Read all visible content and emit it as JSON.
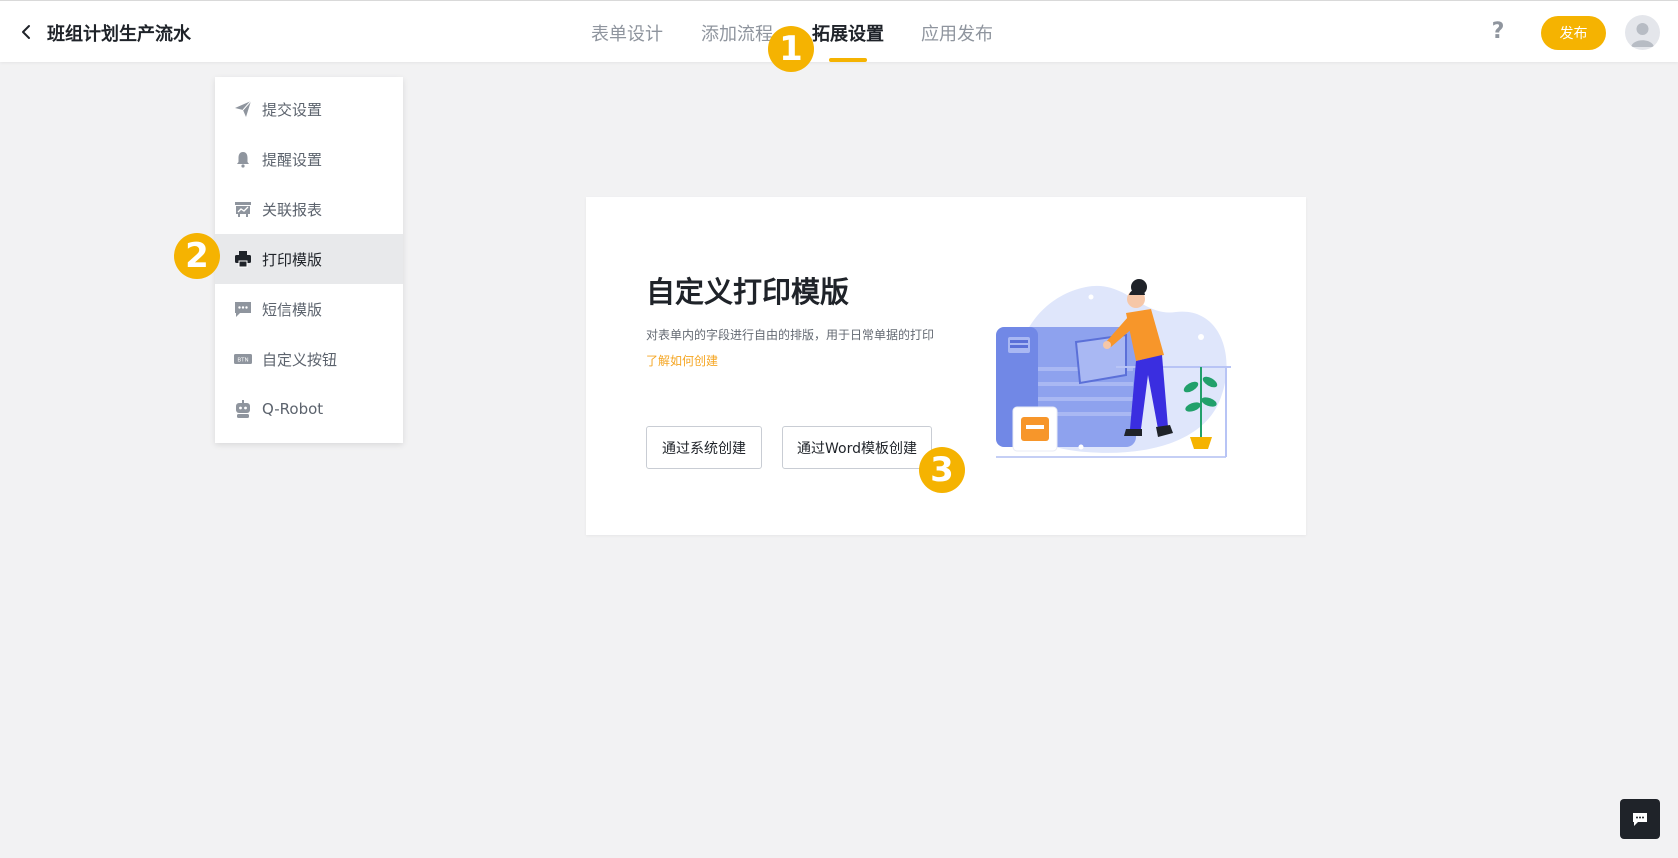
{
  "header": {
    "back_icon": "chevron-left-icon",
    "title": "班组计划生产流水",
    "tabs": [
      {
        "label": "表单设计"
      },
      {
        "label": "添加流程"
      },
      {
        "label": "拓展设置"
      },
      {
        "label": "应用发布"
      }
    ],
    "active_tab": "拓展设置",
    "help_label": "?",
    "publish_label": "发布",
    "avatar_icon": "user-avatar-icon"
  },
  "side_menu": {
    "items": [
      {
        "label": "提交设置",
        "icon": "paper-plane-icon"
      },
      {
        "label": "提醒设置",
        "icon": "bell-icon"
      },
      {
        "label": "关联报表",
        "icon": "report-icon"
      },
      {
        "label": "打印模版",
        "icon": "printer-icon"
      },
      {
        "label": "短信模版",
        "icon": "message-icon"
      },
      {
        "label": "自定义按钮",
        "icon": "btn-badge-icon"
      },
      {
        "label": "Q-Robot",
        "icon": "robot-icon"
      }
    ],
    "active_item": "打印模版"
  },
  "card": {
    "title": "自定义打印模版",
    "description": "对表单内的字段进行自由的排版，用于日常单据的打印",
    "link": "了解如何创建",
    "button_system": "通过系统创建",
    "button_word": "通过Word模板创建",
    "illustration": "printer-illustration"
  },
  "markers": {
    "m1": "1",
    "m2": "2",
    "m3": "3"
  },
  "btn_badge_text": "BTN",
  "chat_icon": "chat-icon",
  "colors": {
    "accent": "#f5b301",
    "link": "#f5a623",
    "background": "#f2f2f3",
    "text_primary": "#1f2329",
    "text_secondary": "#8f959e"
  }
}
